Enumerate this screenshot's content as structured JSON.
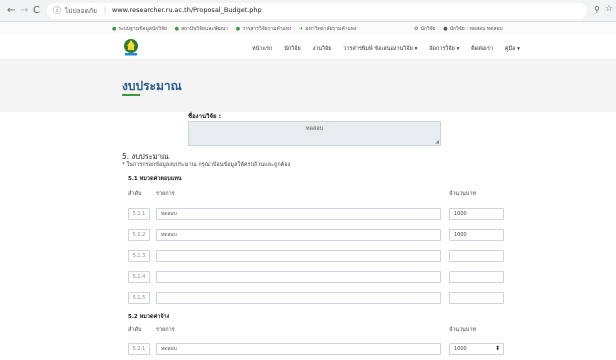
{
  "browser": {
    "back_icon": "←",
    "forward_icon": "→",
    "reload_icon": "C",
    "info_icon": "ⓘ",
    "security_label": "ไม่ปลอดภัย",
    "separator": "|",
    "url": "www.researcher.ru.ac.th/Proposal_Budget.php",
    "zoom_icon": "⚲",
    "star_icon": "☆"
  },
  "top_links": [
    "ระบบฐานข้อมูลนักวิจัย",
    "สถาบันวิจัยและพัฒนา",
    "วารสารวิจัยรามคำแหง",
    "มหาวิทยาลัยรามคำแหง"
  ],
  "top_right": {
    "help_icon": "⚙",
    "help_label": "นักวิจัย",
    "user_icon": "●",
    "user_label": "นักวิจัย : ทดสอบ ทดสอบ"
  },
  "menu": [
    "หน้าแรก",
    "นักวิจัย",
    "งานวิจัย",
    "วารสารพิมพ์ ข้อเสนองานวิจัย ▾",
    "จัดการวิจัย ▾",
    "ติดต่อเรา",
    "คู่มือ ▾"
  ],
  "page_title": "งบประมาณ",
  "project": {
    "label": "ชื่องานวิจัย :",
    "value": "ทดสอบ"
  },
  "section": {
    "title": "5. งบประมาณ",
    "note": "* ในการกรอกข้อมูลงบประมาณ กรุณาป้อนข้อมูลให้ครบถ้วนและถูกต้อง"
  },
  "columns": {
    "order": "ลำดับ",
    "item": "รายการ",
    "amount": "จำนวนบาท"
  },
  "group1": {
    "title": "5.1 หมวดค่าตอบแทน",
    "rows": [
      {
        "code": "5.1.1",
        "item": "ทดสอบ",
        "amount": "1000"
      },
      {
        "code": "5.1.2",
        "item": "ทดสอบ",
        "amount": "1000"
      },
      {
        "code": "5.1.3",
        "item": "",
        "amount": ""
      },
      {
        "code": "5.1.4",
        "item": "",
        "amount": ""
      },
      {
        "code": "5.1.5",
        "item": "",
        "amount": ""
      }
    ]
  },
  "group2": {
    "title": "5.2 หมวดค่าจ้าง",
    "rows": [
      {
        "code": "5.2.1",
        "item": "ทดสอบ",
        "amount": "1000"
      }
    ]
  },
  "spinner_icon": "⬍"
}
